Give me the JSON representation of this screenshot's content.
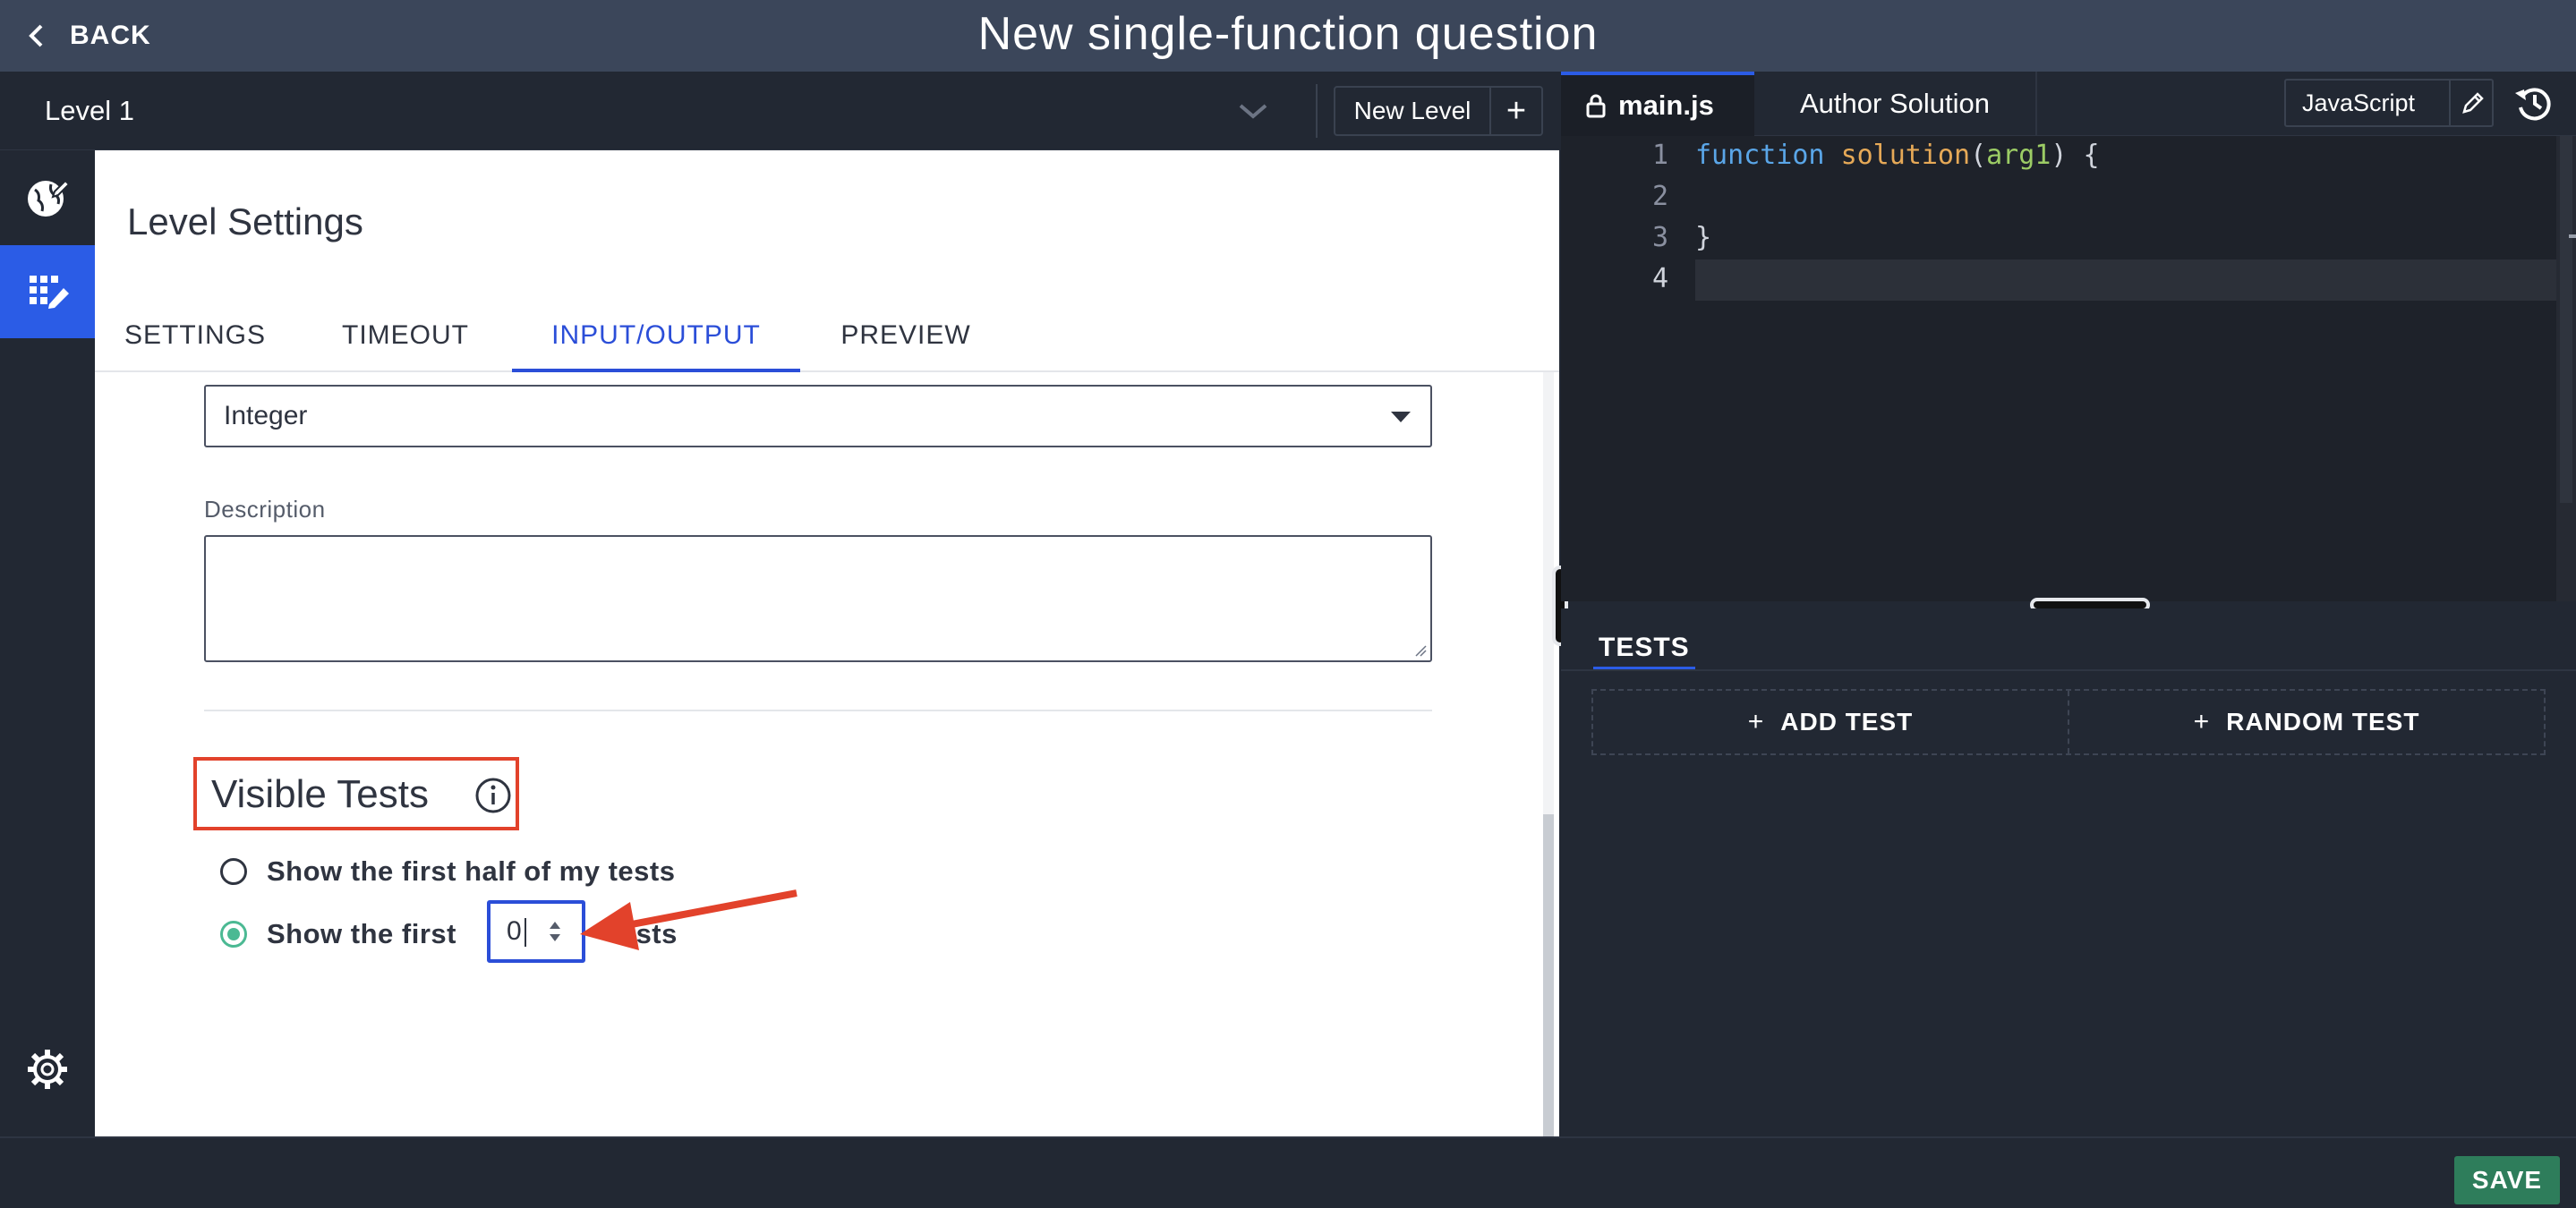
{
  "header": {
    "back_label": "BACK",
    "title": "New single-function question"
  },
  "level_bar": {
    "level_name": "Level 1",
    "new_level_label": "New Level",
    "add_symbol": "+"
  },
  "panel": {
    "title": "Level Settings",
    "tabs": [
      {
        "label": "SETTINGS"
      },
      {
        "label": "TIMEOUT"
      },
      {
        "label": "INPUT/OUTPUT",
        "active": true
      },
      {
        "label": "PREVIEW"
      }
    ],
    "type_select": {
      "value": "Integer"
    },
    "description": {
      "label": "Description",
      "value": ""
    },
    "visible_tests": {
      "title": "Visible Tests",
      "option_half": "Show the first half of my tests",
      "option_first": "Show the first",
      "first_count": "0",
      "suffix": "tests",
      "selected": "first"
    }
  },
  "editor": {
    "file_tab": "main.js",
    "author_tab": "Author Solution",
    "language": "JavaScript",
    "lines": [
      {
        "n": "1",
        "tokens": [
          {
            "t": "function ",
            "c": "kw"
          },
          {
            "t": "solution",
            "c": "fn"
          },
          {
            "t": "(",
            "c": ""
          },
          {
            "t": "arg1",
            "c": "arg"
          },
          {
            "t": ") {",
            "c": ""
          }
        ]
      },
      {
        "n": "2",
        "tokens": []
      },
      {
        "n": "3",
        "tokens": [
          {
            "t": "}",
            "c": ""
          }
        ]
      },
      {
        "n": "4",
        "tokens": []
      }
    ]
  },
  "tests": {
    "tab_label": "TESTS",
    "add_test": "ADD TEST",
    "random_test": "RANDOM TEST",
    "plus": "+"
  },
  "footer": {
    "save_label": "SAVE"
  },
  "colors": {
    "accent": "#2b5ce6",
    "tab_active": "#2b4ed8",
    "radio_on": "#4bb993",
    "highlight": "#e2422b",
    "save": "#2e7d5b"
  }
}
